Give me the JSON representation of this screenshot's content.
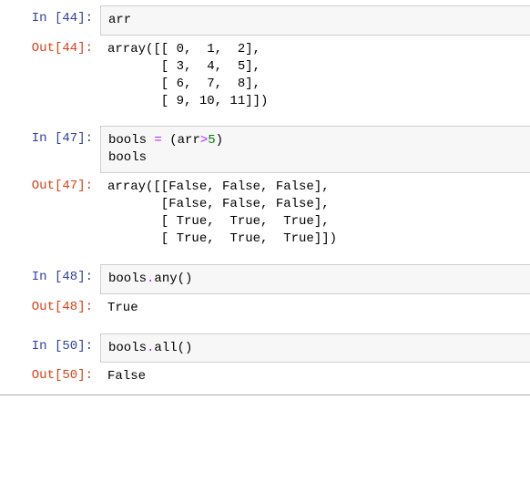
{
  "cells": [
    {
      "in_prompt": "In  [44]:",
      "out_prompt": "Out[44]:",
      "input_html": "<span class='tok-name'>arr</span>",
      "output_text": "array([[ 0,  1,  2],\n       [ 3,  4,  5],\n       [ 6,  7,  8],\n       [ 9, 10, 11]])"
    },
    {
      "in_prompt": "In  [47]:",
      "out_prompt": "Out[47]:",
      "input_html": "<span class='tok-name'>bools</span> <span class='tok-op'>=</span> <span class='tok-paren'>(</span><span class='tok-name'>arr</span><span class='tok-op'>&gt;</span><span class='tok-num'>5</span><span class='tok-paren'>)</span>\n<span class='tok-name'>bools</span>",
      "output_text": "array([[False, False, False],\n       [False, False, False],\n       [ True,  True,  True],\n       [ True,  True,  True]])"
    },
    {
      "in_prompt": "In  [48]:",
      "out_prompt": "Out[48]:",
      "input_html": "<span class='tok-name'>bools</span><span class='tok-op'>.</span><span class='tok-name'>any</span><span class='tok-paren'>()</span>",
      "output_text": "True"
    },
    {
      "in_prompt": "In  [50]:",
      "out_prompt": "Out[50]:",
      "input_html": "<span class='tok-name'>bools</span><span class='tok-op'>.</span><span class='tok-name'>all</span><span class='tok-paren'>()</span>",
      "output_text": "False"
    }
  ]
}
